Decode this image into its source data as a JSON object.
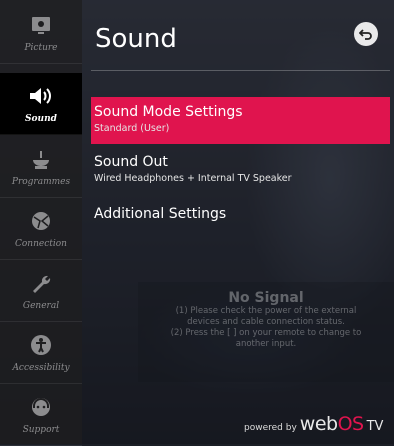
{
  "sidebar": {
    "items": [
      {
        "label": "Picture",
        "icon": "picture-icon",
        "active": false
      },
      {
        "label": "Sound",
        "icon": "speaker-icon",
        "active": true
      },
      {
        "label": "Programmes",
        "icon": "antenna-icon",
        "active": false
      },
      {
        "label": "Connection",
        "icon": "network-globe-icon",
        "active": false
      },
      {
        "label": "General",
        "icon": "wrench-icon",
        "active": false
      },
      {
        "label": "Accessibility",
        "icon": "accessibility-icon",
        "active": false
      },
      {
        "label": "Support",
        "icon": "support-headset-icon",
        "active": false
      }
    ]
  },
  "header": {
    "title": "Sound",
    "back_icon": "back-arrow-icon"
  },
  "menu": {
    "items": [
      {
        "label": "Sound Mode Settings",
        "value": "Standard (User)",
        "selected": true
      },
      {
        "label": "Sound Out",
        "value": "Wired Headphones + Internal TV Speaker",
        "selected": false
      },
      {
        "label": "Additional Settings",
        "value": "",
        "selected": false
      }
    ]
  },
  "no_signal": {
    "title": "No Signal",
    "line1": "(1) Please check the power of the external",
    "line2": "devices and cable connection status.",
    "line3": "(2) Press the [ ] on your remote to change to",
    "line4": "another input."
  },
  "footer": {
    "powered": "powered by",
    "web": "web",
    "os": "OS",
    "tv": "TV"
  },
  "colors": {
    "accent": "#e0144e",
    "sidebar_bg": "#1e1e20",
    "active_bg": "#000000"
  }
}
